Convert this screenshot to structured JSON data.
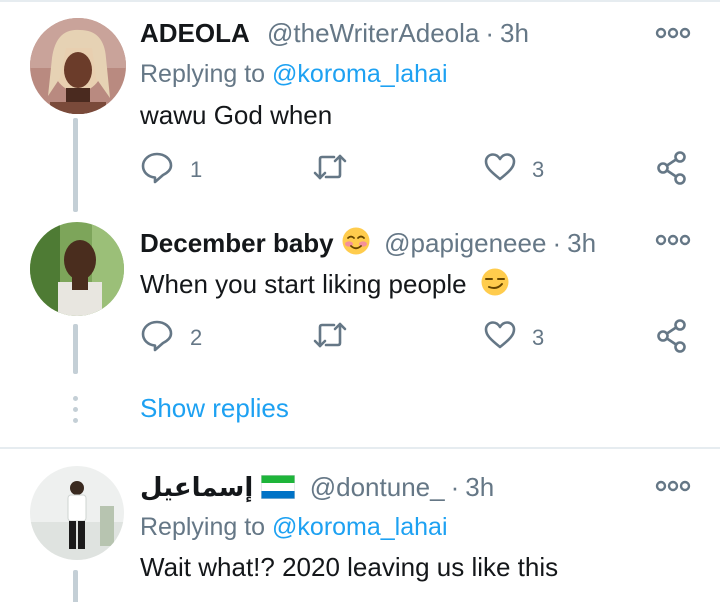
{
  "tweets": [
    {
      "name": "ADEOLA",
      "handle": "@theWriterAdeola",
      "separator": "·",
      "time": "3h",
      "replying_prefix": "Replying to",
      "replying_to": "@koroma_lahai",
      "text": "wawu God when",
      "reply_count": "1",
      "retweet_count": "",
      "like_count": "3"
    },
    {
      "name": "December baby",
      "name_emoji": "smiling-face-with-blush",
      "handle": "@papigeneee",
      "separator": "·",
      "time": "3h",
      "text": "When you start liking people",
      "text_emoji": "smirking-face",
      "reply_count": "2",
      "retweet_count": "",
      "like_count": "3"
    },
    {
      "name": "إسماعيل",
      "name_emoji": "sierra-leone-flag",
      "handle": "@dontune_",
      "separator": "·",
      "time": "3h",
      "replying_prefix": "Replying to",
      "replying_to": "@koroma_lahai",
      "text": "Wait what!? 2020 leaving us like this"
    }
  ],
  "show_replies": "Show replies",
  "colors": {
    "link": "#1da1f2",
    "secondary_text": "#657786",
    "primary_text": "#14171a",
    "thread_line": "#c4cfd6",
    "divider": "#e6ecf0",
    "flag_green": "#1eb53a",
    "flag_white": "#ffffff",
    "flag_blue": "#0072c6"
  },
  "icons": [
    "reply-icon",
    "retweet-icon",
    "like-icon",
    "share-icon",
    "more-options-icon"
  ]
}
